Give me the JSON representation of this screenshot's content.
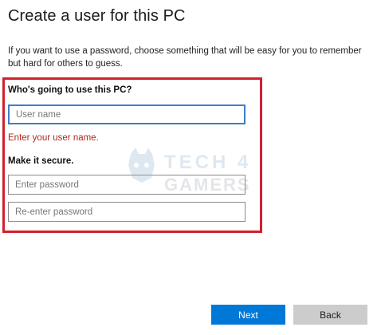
{
  "header": {
    "title": "Create a user for this PC"
  },
  "intro": {
    "text": "If you want to use a password, choose something that will be easy for you to remember but hard for others to guess."
  },
  "user_section": {
    "heading": "Who's going to use this PC?",
    "username_placeholder": "User name",
    "username_value": "",
    "error": "Enter your user name."
  },
  "security_section": {
    "heading": "Make it secure.",
    "password_placeholder": "Enter password",
    "repassword_placeholder": "Re-enter password"
  },
  "watermark": {
    "brand_line1": "TECH 4",
    "brand_line2": "GAMERS"
  },
  "footer": {
    "next_label": "Next",
    "back_label": "Back"
  },
  "colors": {
    "accent": "#0078d7",
    "highlight_border": "#d0202e",
    "error": "#b3261e",
    "focus_border": "#3c7fc6"
  }
}
